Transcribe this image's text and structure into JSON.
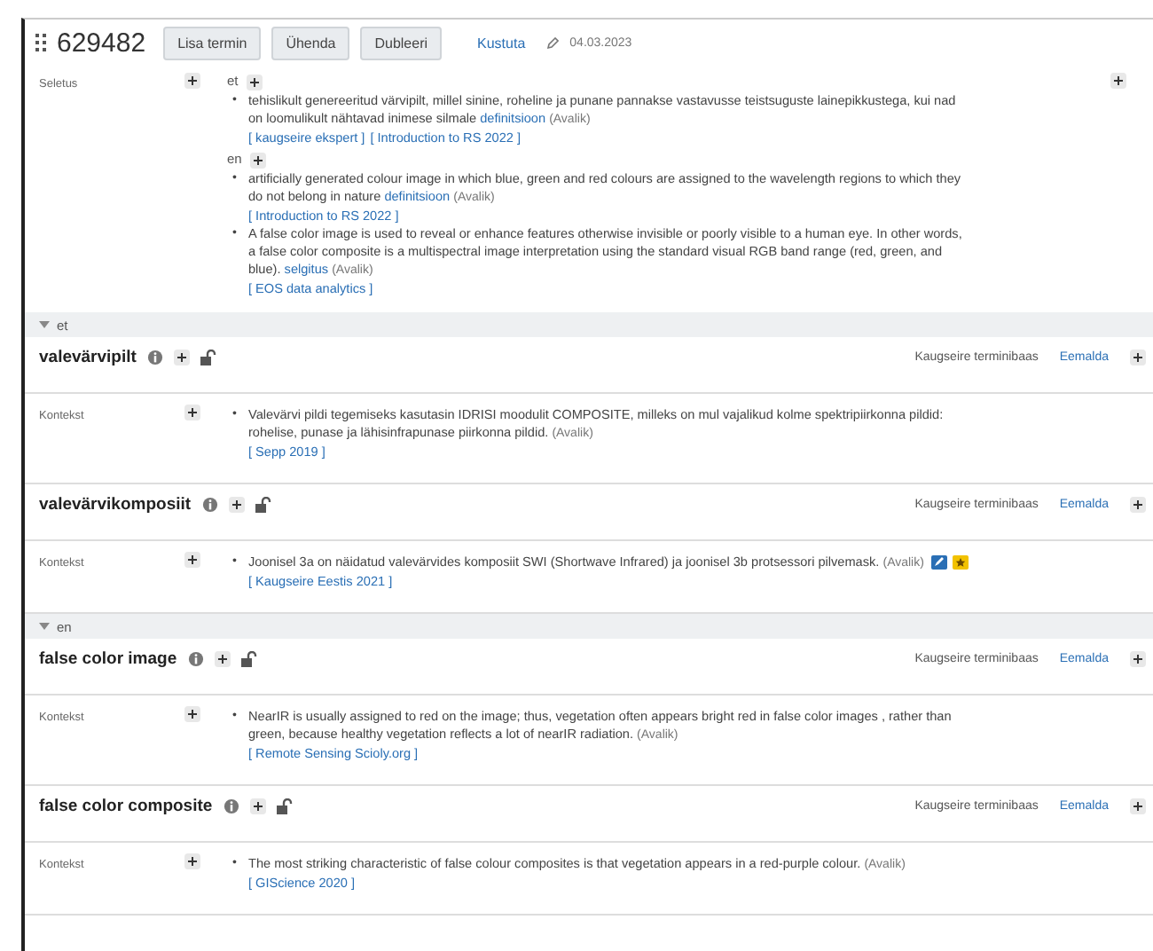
{
  "header": {
    "id": "629482",
    "buttons": [
      "Lisa termin",
      "Ühenda",
      "Dubleeri"
    ],
    "delete": "Kustuta",
    "date": "04.03.2023"
  },
  "definition": {
    "label": "Seletus",
    "groups": [
      {
        "lang": "et",
        "items": [
          {
            "marker": "•",
            "text": "tehislikult genereeritud värvipilt, millel sinine, roheline ja punane pannakse vastavusse teistsuguste lainepikkustega, kui nad on loomulikult nähtavad inimese silmale",
            "link": "definitsioon",
            "tag": "(Avalik)",
            "sources": [
              "[ kaugseire ekspert ]",
              "[ Introduction to RS 2022 ]"
            ]
          }
        ]
      },
      {
        "lang": "en",
        "items": [
          {
            "marker": "•",
            "text": "artificially generated colour image in which blue, green and red colours are assigned to the wavelength regions to which they do not belong in nature",
            "link": "definitsioon",
            "tag": "(Avalik)",
            "sources": [
              "[ Introduction to RS 2022 ]"
            ]
          },
          {
            "marker": "•",
            "text": "A false color image is used to reveal or enhance features otherwise invisible or poorly visible to a human eye. In other words, a false color composite is a multispectral image interpretation using the standard visual RGB band range (red, green, and blue).",
            "link": "selgitus",
            "tag": "(Avalik)",
            "sources": [
              "[ EOS data analytics ]"
            ]
          }
        ]
      }
    ]
  },
  "sections": [
    {
      "lang": "et",
      "expanded": true,
      "terms": [
        {
          "name": "valevärvipilt",
          "base": "Kaugseire terminibaas",
          "remove": "Eemalda",
          "context_label": "Kontekst",
          "contexts": [
            {
              "marker": "•",
              "text": "Valevärvi pildi tegemiseks kasutasin IDRISI moodulit COMPOSITE, milleks on mul vajalikud kolme spektripiirkonna pildid: rohelise, punase ja lähisinfrapunase piirkonna pildid.",
              "tag": "(Avalik)",
              "sources": [
                "[ Sepp 2019 ]"
              ],
              "has_actions": false
            }
          ]
        },
        {
          "name": "valevärvikomposiit",
          "base": "Kaugseire terminibaas",
          "remove": "Eemalda",
          "context_label": "Kontekst",
          "contexts": [
            {
              "marker": "•",
              "text": "Joonisel 3a on näidatud valevärvides komposiit SWI (Shortwave Infrared) ja joonisel 3b protsessori pilvemask.",
              "tag": "(Avalik)",
              "sources": [
                "[ Kaugseire Eestis 2021 ]"
              ],
              "has_actions": true
            }
          ]
        }
      ]
    },
    {
      "lang": "en",
      "expanded": true,
      "terms": [
        {
          "name": "false color image",
          "base": "Kaugseire terminibaas",
          "remove": "Eemalda",
          "context_label": "Kontekst",
          "contexts": [
            {
              "marker": "•",
              "text": "NearIR is usually assigned to red on the image; thus, vegetation often appears bright red in false color images , rather than green, because healthy vegetation reflects a lot of nearIR radiation.",
              "tag": "(Avalik)",
              "sources": [
                "[ Remote Sensing Scioly.org ]"
              ],
              "has_actions": false
            }
          ]
        },
        {
          "name": "false color composite",
          "base": "Kaugseire terminibaas",
          "remove": "Eemalda",
          "context_label": "Kontekst",
          "contexts": [
            {
              "marker": "•",
              "text": "The most striking characteristic of false colour composites is that vegetation appears in a red-purple colour.",
              "tag": "(Avalik)",
              "sources": [
                "[ GIScience 2020 ]"
              ],
              "has_actions": false
            }
          ]
        }
      ]
    }
  ]
}
